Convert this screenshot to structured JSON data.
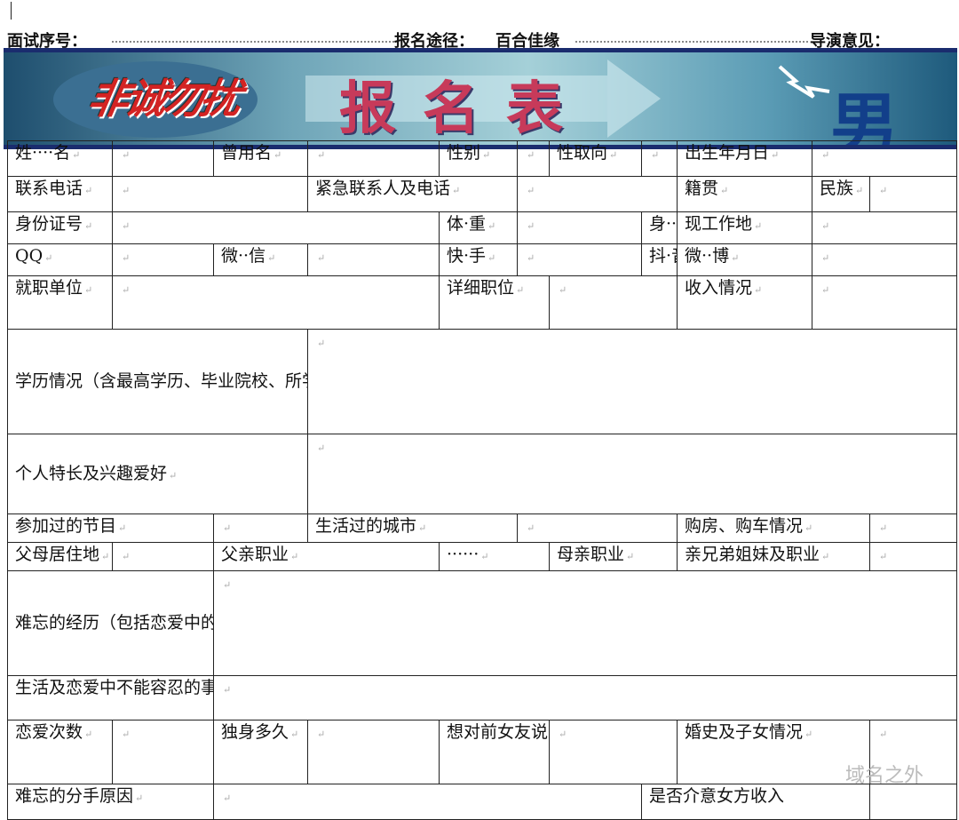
{
  "header": {
    "seq_label": "面试序号：",
    "route_label": "报名途径：",
    "route_value": "百合佳缘",
    "director_label": "导演意见："
  },
  "banner": {
    "logo": "非诚勿扰",
    "title": "报名表",
    "gender": "男"
  },
  "form": {
    "name": "姓····名",
    "former_name": "曾用名",
    "gender": "性别",
    "orientation": "性取向",
    "birthdate": "出生年月日",
    "phone": "联系电话",
    "emergency": "紧急联系人及电话",
    "native_place": "籍贯",
    "ethnicity": "民族",
    "id_number": "身份证号",
    "weight": "体·重",
    "height": "身··高",
    "workplace": "现工作地",
    "qq": "QQ",
    "wechat": "微··信",
    "kuaishou": "快·手",
    "douyin": "抖·音",
    "weibo": "微··博",
    "employer": "就职单位",
    "position": "详细职位",
    "income": "收入情况",
    "education": "学历情况（含最高学历、毕业院校、所学专业，请尽量详细填写）",
    "hobbies": "个人特长及兴趣爱好",
    "shows": "参加过的节目",
    "cities": "生活过的城市",
    "property": "购房、购车情况",
    "parents_home": "父母居住地",
    "father_job": "父亲职业",
    "father_job_value": "······",
    "mother_job": "母亲职业",
    "siblings": "亲兄弟姐妹及职业",
    "memorable": "难忘的经历（包括恋爱中的）",
    "intolerable": "生活及恋爱中不能容忍的事",
    "relationships": "恋爱次数",
    "single_time": "独身多久",
    "ex_message": "想对前女友说",
    "marriage": "婚史及子女情况",
    "breakup_reason": "难忘的分手原因",
    "income_concern": "是否介意女方收入"
  },
  "watermark": "域名之外",
  "mark": "↵"
}
